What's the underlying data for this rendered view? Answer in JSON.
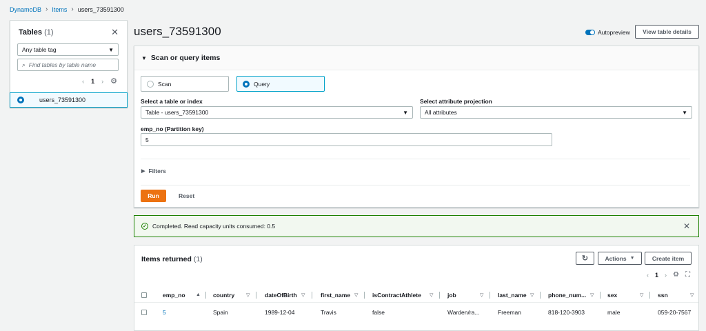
{
  "breadcrumb": {
    "root": "DynamoDB",
    "items": "Items",
    "current": "users_73591300"
  },
  "left_panel": {
    "title": "Tables",
    "count": "(1)",
    "tag_select": "Any table tag",
    "find_placeholder": "Find tables by table name",
    "page": "1",
    "selected_table": "users_73591300"
  },
  "page_title": "users_73591300",
  "autopreview_label": "Autopreview",
  "view_table_details": "View table details",
  "scan_query": {
    "header": "Scan or query items",
    "scan_label": "Scan",
    "query_label": "Query",
    "selected_mode": "Query",
    "table_index_label": "Select a table or index",
    "table_index_value": "Table - users_73591300",
    "projection_label": "Select attribute projection",
    "projection_value": "All attributes",
    "partition_key_label": "emp_no (Partition key)",
    "partition_key_value": "5",
    "filters_label": "Filters",
    "run_label": "Run",
    "reset_label": "Reset"
  },
  "flash": {
    "message": "Completed. Read capacity units consumed: 0.5",
    "status_color": "#1d8102"
  },
  "items": {
    "title": "Items returned",
    "count": "(1)",
    "actions_label": "Actions",
    "create_label": "Create item",
    "page": "1",
    "columns": [
      "emp_no",
      "country",
      "dateOfBirth",
      "first_name",
      "isContractAthlete",
      "job",
      "last_name",
      "phone_num...",
      "sex",
      "ssn"
    ],
    "rows": [
      [
        "5",
        "Spain",
        "1989-12-04",
        "Travis",
        "false",
        "Warden/ra...",
        "Freeman",
        "818-120-3903",
        "male",
        "059-20-7567"
      ]
    ]
  },
  "colors": {
    "accent": "#0073bb",
    "primary_button": "#ec7211",
    "success": "#1d8102"
  }
}
